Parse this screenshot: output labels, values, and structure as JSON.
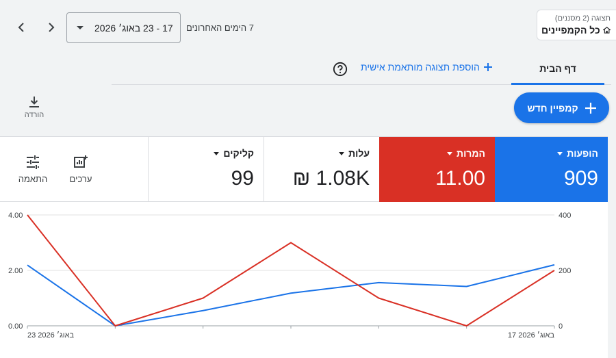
{
  "view": {
    "sub": "תצוגה (2 מסננים)",
    "title": "כל הקמפיינים",
    "icon": "home-icon"
  },
  "date": {
    "range_label": "7 הימים האחרונים",
    "value": "17 - 23 באוג׳ 2026"
  },
  "tabs": {
    "home": "דף הבית",
    "add_view": "הוספת תצוגה מותאמת אישית"
  },
  "actions": {
    "new_campaign": "קמפיין חדש",
    "download": "הורדה"
  },
  "metrics": [
    {
      "label": "הופעות",
      "value": "909",
      "color": "#1a73e8"
    },
    {
      "label": "המרות",
      "value": "11.00",
      "color": "#d93025"
    },
    {
      "label": "עלות",
      "value": "1.08K ₪"
    },
    {
      "label": "קליקים",
      "value": "99"
    }
  ],
  "tools": {
    "values": "ערכים",
    "adjust": "התאמה"
  },
  "chart_data": {
    "type": "line",
    "x": [
      "17 באוג׳ 2026",
      "18",
      "19",
      "20",
      "21",
      "22",
      "23 באוג׳ 2026"
    ],
    "x_tick_labels": [
      "17 באוג׳ 2026",
      "23 באוג׳ 2026"
    ],
    "series": [
      {
        "name": "הופעות",
        "color": "#1a73e8",
        "axis": "right",
        "values": [
          220,
          142,
          156,
          118,
          55,
          0,
          219
        ]
      },
      {
        "name": "המרות",
        "color": "#d93025",
        "axis": "left",
        "values": [
          2,
          0,
          1,
          3,
          1,
          0,
          4
        ]
      }
    ],
    "left_axis": {
      "ticks": [
        "0.00",
        "2.00",
        "4.00"
      ],
      "range": [
        0,
        4
      ]
    },
    "right_axis": {
      "ticks": [
        "0",
        "200",
        "400"
      ],
      "range": [
        0,
        400
      ]
    },
    "grid": true
  }
}
